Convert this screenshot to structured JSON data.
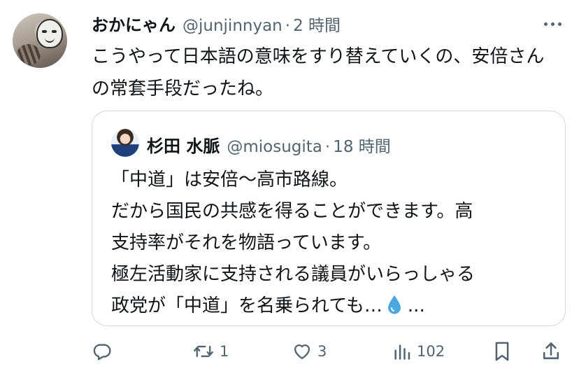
{
  "tweet": {
    "display_name": "おかにゃん",
    "handle": "@junjinnyan",
    "separator": "·",
    "time": "2 時間",
    "text": "こうやって日本語の意味をすり替えていくの、安倍さんの常套手段だったね。"
  },
  "quote": {
    "display_name": "杉田 水脈",
    "handle": "@miosugita",
    "separator": "·",
    "time": "18 時間",
    "lines": [
      "「中道」は安倍〜高市路線。",
      "だから国民の共感を得ることができます。高",
      "支持率がそれを物語っています。",
      "極左活動家に支持される議員がいらっしゃる"
    ],
    "last_line_text": "政党が「中道」を名乗られても…",
    "last_line_suffix": "...",
    "emoji_icon": "droplet-icon"
  },
  "actions": {
    "reply_icon": "reply-icon",
    "retweet_icon": "retweet-icon",
    "retweet_count": "1",
    "like_icon": "heart-icon",
    "like_count": "3",
    "views_icon": "views-icon",
    "views_count": "102",
    "bookmark_icon": "bookmark-icon",
    "share_icon": "share-icon"
  },
  "colors": {
    "text_primary": "#0f1419",
    "text_secondary": "#536471",
    "border": "#cfd9de",
    "droplet": "#4aa8e0"
  }
}
